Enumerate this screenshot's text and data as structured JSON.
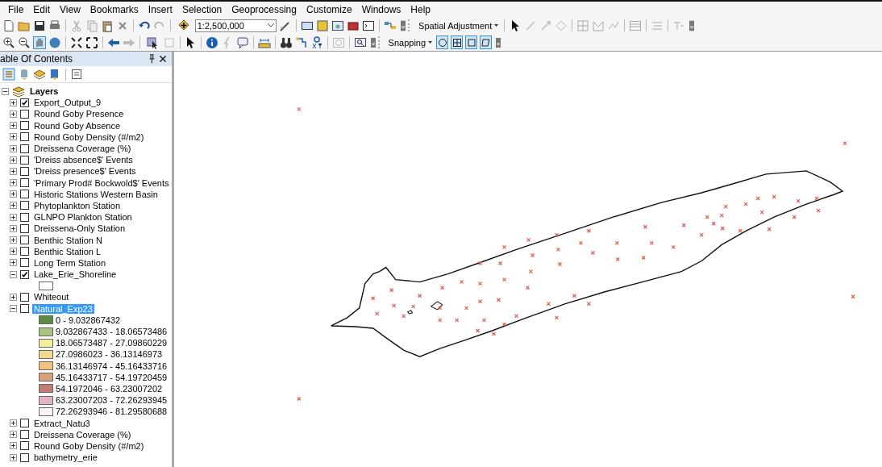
{
  "menu": [
    "File",
    "Edit",
    "View",
    "Bookmarks",
    "Insert",
    "Selection",
    "Geoprocessing",
    "Customize",
    "Windows",
    "Help"
  ],
  "toolbar": {
    "scale_field": {
      "value": "1:2,500,000"
    },
    "spatial_adjustment": "Spatial Adjustment",
    "snapping": {
      "label": "Snapping",
      "buttons": [
        {
          "kind": "circle",
          "on": true
        },
        {
          "kind": "grid",
          "on": true
        },
        {
          "kind": "square",
          "on": true
        },
        {
          "kind": "edge",
          "on": true
        }
      ]
    }
  },
  "toc": {
    "title": "able Of Contents",
    "root": {
      "label": "Layers",
      "expanded": true,
      "children": [
        {
          "label": "Export_Output_9",
          "checked": true,
          "expanded": false,
          "selected": false
        },
        {
          "label": "Round Goby Presence",
          "checked": false,
          "expanded": false,
          "selected": false
        },
        {
          "label": "Round Goby Absence",
          "checked": false,
          "expanded": false,
          "selected": false
        },
        {
          "label": "Round Goby Density (#/m2)",
          "checked": false,
          "expanded": false,
          "selected": false
        },
        {
          "label": "Dreissena Coverage (%)",
          "checked": false,
          "expanded": false,
          "selected": false
        },
        {
          "label": "'Dreiss absence$' Events",
          "checked": false,
          "expanded": false,
          "selected": false
        },
        {
          "label": "'Dreiss presence$' Events",
          "checked": false,
          "expanded": false,
          "selected": false
        },
        {
          "label": "'Primary Prod# Bockwold$' Events",
          "checked": false,
          "expanded": false,
          "selected": false
        },
        {
          "label": "Historic Stations Western Basin",
          "checked": false,
          "expanded": false,
          "selected": false
        },
        {
          "label": "Phytoplankton Station",
          "checked": false,
          "expanded": false,
          "selected": false
        },
        {
          "label": "GLNPO Plankton Station",
          "checked": false,
          "expanded": false,
          "selected": false
        },
        {
          "label": "Dreissena-Only Station",
          "checked": false,
          "expanded": false,
          "selected": false
        },
        {
          "label": "Benthic Station N",
          "checked": false,
          "expanded": false,
          "selected": false
        },
        {
          "label": "Benthic Station L",
          "checked": false,
          "expanded": false,
          "selected": false
        },
        {
          "label": "Long Term Station",
          "checked": false,
          "expanded": false,
          "selected": false
        },
        {
          "label": "Lake_Erie_Shoreline",
          "checked": true,
          "expanded": true,
          "selected": false,
          "legend": [
            {
              "color": "#ffffff"
            }
          ]
        },
        {
          "label": "Whiteout",
          "checked": false,
          "expanded": false,
          "selected": false
        },
        {
          "label": "Natural_Exp23",
          "checked": false,
          "expanded": true,
          "selected": true,
          "legend": [
            {
              "label": "0 - 9.032867432",
              "color": "#5f8a45"
            },
            {
              "label": "9.032867433 - 18.06573486",
              "color": "#a9c47f"
            },
            {
              "label": "18.06573487 - 27.09860229",
              "color": "#f2ee9e"
            },
            {
              "label": "27.0986023 - 36.13146973",
              "color": "#f3d98e"
            },
            {
              "label": "36.13146974 - 45.16433716",
              "color": "#f0c27e"
            },
            {
              "label": "45.16433717 - 54.19720459",
              "color": "#d9a27c"
            },
            {
              "label": "54.1972046 - 63.23007202",
              "color": "#c07c6e"
            },
            {
              "label": "63.23007203 - 72.26293945",
              "color": "#e4b5c0"
            },
            {
              "label": "72.26293946 - 81.29580688",
              "color": "#fbf0f6"
            }
          ]
        },
        {
          "label": "Extract_Natu3",
          "checked": false,
          "expanded": false,
          "selected": false
        },
        {
          "label": "Dreissena Coverage (%)",
          "checked": false,
          "expanded": false,
          "selected": false
        },
        {
          "label": "Round Goby Density (#/m2)",
          "checked": false,
          "expanded": false,
          "selected": false
        },
        {
          "label": "bathymetry_erie",
          "checked": false,
          "expanded": false,
          "selected": false
        }
      ]
    }
  }
}
